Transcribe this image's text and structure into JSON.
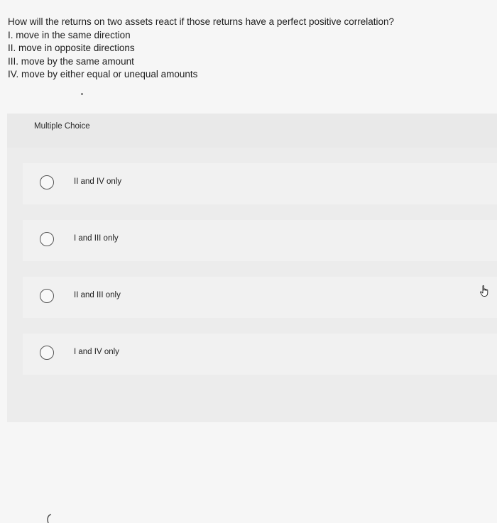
{
  "question": {
    "prompt": "How will the returns on two assets react if those returns have a perfect positive correlation?",
    "statements": [
      "I. move in the same direction",
      "II. move in opposite directions",
      "III. move by the same amount",
      "IV. move by either equal or unequal amounts"
    ]
  },
  "multiple_choice": {
    "title": "Multiple Choice",
    "options": [
      {
        "label": "II and IV only"
      },
      {
        "label": "I and III only"
      },
      {
        "label": "II and III only"
      },
      {
        "label": "I and IV only"
      }
    ]
  },
  "icons": {
    "cursor": "hand-pointer-icon",
    "radio": "radio-empty-icon"
  }
}
